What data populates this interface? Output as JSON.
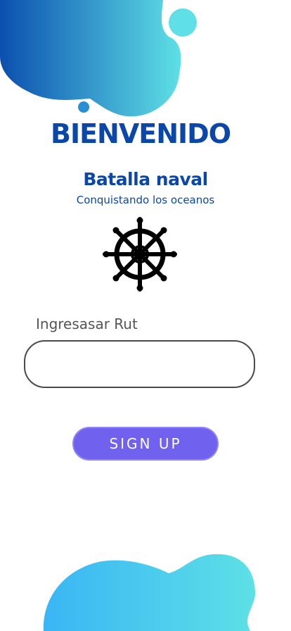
{
  "welcome": {
    "title": "BIENVENIDO"
  },
  "game": {
    "title": "Batalla naval",
    "subtitle": "Conquistando los oceanos",
    "icon": "ship-wheel-icon"
  },
  "form": {
    "rut_label": "Ingresasar Rut",
    "rut_value": "",
    "signup_label": "SIGN UP"
  },
  "colors": {
    "brand_blue": "#0a47a9",
    "button_purple": "#7062ef",
    "blob_gradient_start": "#0b4fae",
    "blob_gradient_end": "#5ee0e6",
    "bottom_blob_start": "#39b6f4",
    "bottom_blob_end": "#5ee0e6"
  }
}
